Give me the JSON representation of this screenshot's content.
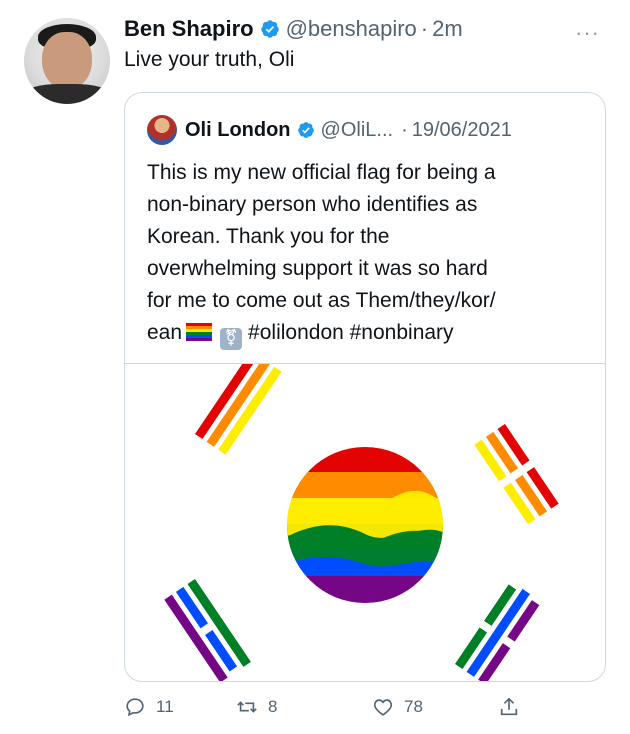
{
  "tweet": {
    "author_name": "Ben Shapiro",
    "handle": "@benshapiro",
    "separator": "·",
    "time": "2m",
    "more_label": "···",
    "text": "Live your truth, Oli"
  },
  "quoted": {
    "author_name": "Oli London",
    "handle": "@OliL...",
    "separator": "·",
    "date": "19/06/2021",
    "lines": [
      "This is my new official flag for being a",
      "non-binary person who identifies as",
      "Korean.  Thank you for the",
      "overwhelming support it was so hard",
      "for me to come out as Them/they/kor/"
    ],
    "last_line_start": "ean",
    "hashtags": "#olilondon #nonbinary"
  },
  "actions": {
    "reply_count": "11",
    "retweet_count": "8",
    "like_count": "78"
  },
  "icons": [
    "verified-icon",
    "more-icon",
    "reply-icon",
    "retweet-icon",
    "like-icon",
    "share-icon"
  ],
  "colors": {
    "verified": "#1d9bf0",
    "text_primary": "#0f1419",
    "text_secondary": "#536471",
    "border": "#cfd9de"
  }
}
